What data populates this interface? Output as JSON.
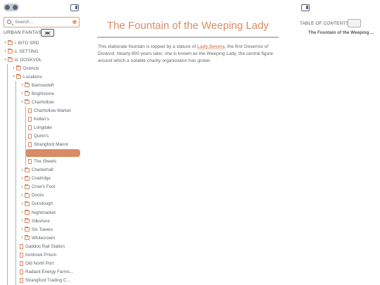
{
  "sidebar": {
    "search_placeholder": "Search...",
    "vault_title": "URBAN FANTASY",
    "tree": [
      {
        "label": "i. BITD SRD",
        "type": "folder",
        "level": 0,
        "expanded": false
      },
      {
        "label": "ii. SETTING",
        "type": "folder",
        "level": 0,
        "expanded": false
      },
      {
        "label": "iii. DOSKVOL",
        "type": "folder",
        "level": 0,
        "expanded": true
      },
      {
        "label": "Districts",
        "type": "folder",
        "level": 1,
        "expanded": false
      },
      {
        "label": "Locations",
        "type": "folder",
        "level": 1,
        "expanded": true
      },
      {
        "label": "Barrowcleft",
        "type": "folder",
        "level": 2,
        "expanded": false
      },
      {
        "label": "Brightstone",
        "type": "folder",
        "level": 2,
        "expanded": false
      },
      {
        "label": "Charhollow",
        "type": "folder",
        "level": 2,
        "expanded": true
      },
      {
        "label": "Charhollow Market",
        "type": "file",
        "level": 3
      },
      {
        "label": "Kellen's",
        "type": "file",
        "level": 3
      },
      {
        "label": "Longdale",
        "type": "file",
        "level": 3
      },
      {
        "label": "Quinn's",
        "type": "file",
        "level": 3
      },
      {
        "label": "Strangford Manor",
        "type": "file",
        "level": 3
      },
      {
        "label": "",
        "type": "selected",
        "level": 3
      },
      {
        "label": "The Sheets",
        "type": "file",
        "level": 3
      },
      {
        "label": "Charterhall",
        "type": "folder",
        "level": 2,
        "expanded": false
      },
      {
        "label": "Coalridge",
        "type": "folder",
        "level": 2,
        "expanded": false
      },
      {
        "label": "Crow's Foot",
        "type": "folder",
        "level": 2,
        "expanded": false
      },
      {
        "label": "Docks",
        "type": "folder",
        "level": 2,
        "expanded": false
      },
      {
        "label": "Dunslough",
        "type": "folder",
        "level": 2,
        "expanded": false
      },
      {
        "label": "Nightmarket",
        "type": "folder",
        "level": 2,
        "expanded": false
      },
      {
        "label": "Silkshore",
        "type": "folder",
        "level": 2,
        "expanded": false
      },
      {
        "label": "Six Towers",
        "type": "folder",
        "level": 2,
        "expanded": false
      },
      {
        "label": "Whitecrown",
        "type": "folder",
        "level": 2,
        "expanded": false
      },
      {
        "label": "Gaddoc Rail Station",
        "type": "file",
        "level": 2
      },
      {
        "label": "Ironhook Prison",
        "type": "file",
        "level": 2
      },
      {
        "label": "Old North Port",
        "type": "file",
        "level": 2
      },
      {
        "label": "Radiant Energy Farms...",
        "type": "file",
        "level": 2
      },
      {
        "label": "Strangford Trading C...",
        "type": "file",
        "level": 2
      }
    ]
  },
  "main": {
    "title": "The Fountain of the Weeping Lady",
    "body_before": "This elaborate fountain is topped by a stature of ",
    "link_text": "Lady Devera",
    "body_after": ", the first Governor of Doskvol. Nearly 800 years later, she is known as the Weeping Lady, the central figure around which a notable charity organization has grown."
  },
  "toc": {
    "title": "TABLE OF CONTENTS",
    "items": [
      "The Fountain of the Weeping ..."
    ]
  },
  "colors": {
    "accent": "#d98b65",
    "selected_bg": "#d98b65"
  }
}
